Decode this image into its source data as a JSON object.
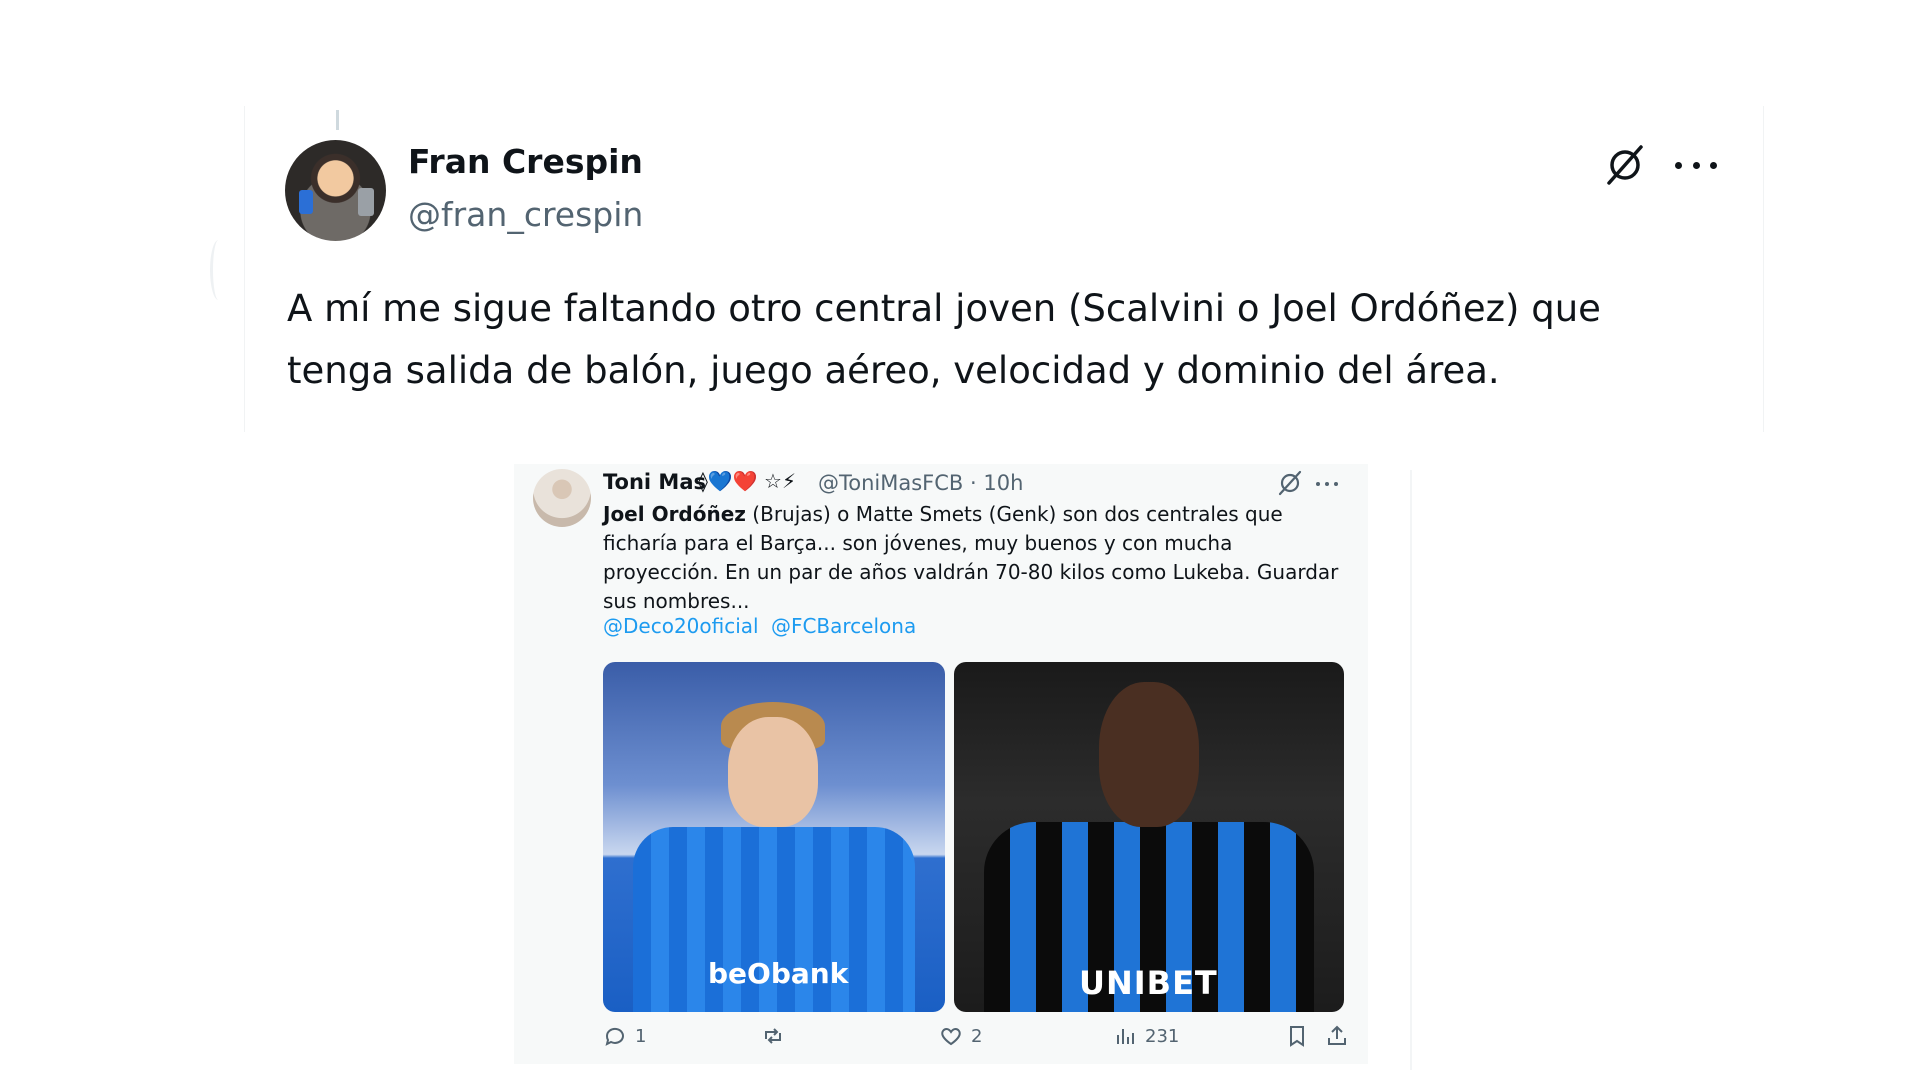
{
  "tweet": {
    "author_name": "Fran Crespin",
    "author_handle": "@fran_crespin",
    "text": "A mí me sigue faltando otro central joven (Scalvini o Joel Ordóñez) que tenga salida de balón, juego aéreo, velocidad y dominio del área.",
    "icons": [
      "grok-icon",
      "more-icon"
    ]
  },
  "quoted": {
    "author_name": "Toni Mas",
    "emoji_badges": "◊💙❤️ ☆⚡",
    "handle_time": "@ToniMasFCB · 10h",
    "text_bold": "Joel Ordóñez",
    "text_rest": " (Brujas) o Matte Smets (Genk) son dos centrales que ficharía para el Barça... son jóvenes, muy buenos y con mucha proyección. En un par de años valdrán 70-80 kilos como Lukeba. Guardar sus nombres...",
    "mentions": [
      "@Deco20oficial",
      "@FCBarcelona"
    ],
    "photo_1_sponsor": "beObank",
    "photo_2_sponsor": "UNIBET",
    "actions": {
      "replies": "1",
      "likes": "2",
      "views": "231"
    },
    "action_icons": [
      "reply-icon",
      "retweet-icon",
      "like-icon",
      "views-icon",
      "bookmark-icon",
      "share-icon"
    ],
    "accent_color": "#1d9bf0"
  }
}
